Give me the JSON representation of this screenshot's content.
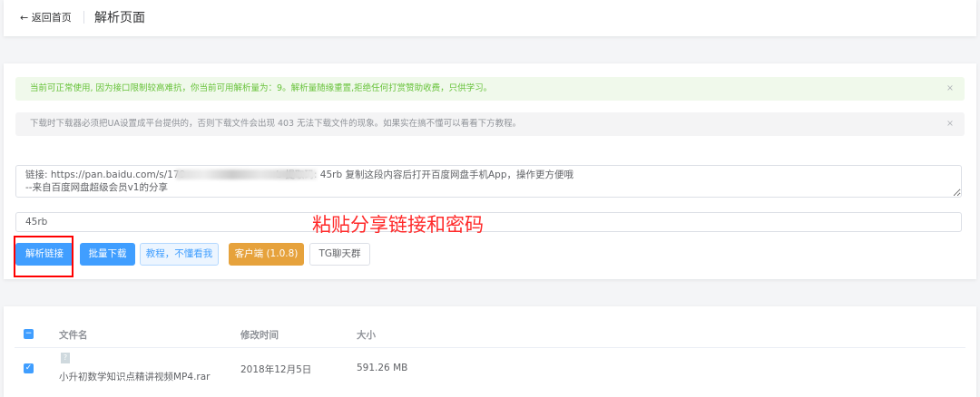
{
  "header": {
    "back_label": "← 返回首页",
    "title": "解析页面"
  },
  "alerts": [
    {
      "text": "当前可正常使用, 因为接口限制较高难抗，你当前可用解析量为：9。解析量随缘重置,拒绝任何打赏赞助收费，只供学习。",
      "close": "×"
    },
    {
      "text": "下载时下载器必须把UA设置成平台提供的，否则下载文件会出现 403 无法下载文件的现象。如果实在搞不懂可以看看下方教程。",
      "close": "×"
    }
  ],
  "link_input": {
    "value": "链接: https://pan.baidu.com/s/179                              b 提取码: 45rb 复制这段内容后打开百度网盘手机App，操作更方便哦\n--来自百度网盘超级会员v1的分享"
  },
  "password_input": {
    "value": "45rb"
  },
  "annotation": "粘贴分享链接和密码",
  "buttons": {
    "parse": "解析链接",
    "batch": "批量下载",
    "tutorial": "教程，不懂看我",
    "client": "客户端 (1.0.8)",
    "tg": "TG聊天群"
  },
  "table": {
    "headers": {
      "name": "文件名",
      "modified": "修改时间",
      "size": "大小"
    },
    "rows": [
      {
        "name": "小升初数学知识点精讲视频MP4.rar",
        "modified": "2018年12月5日",
        "size": "591.26 MB",
        "checked": true
      }
    ]
  }
}
